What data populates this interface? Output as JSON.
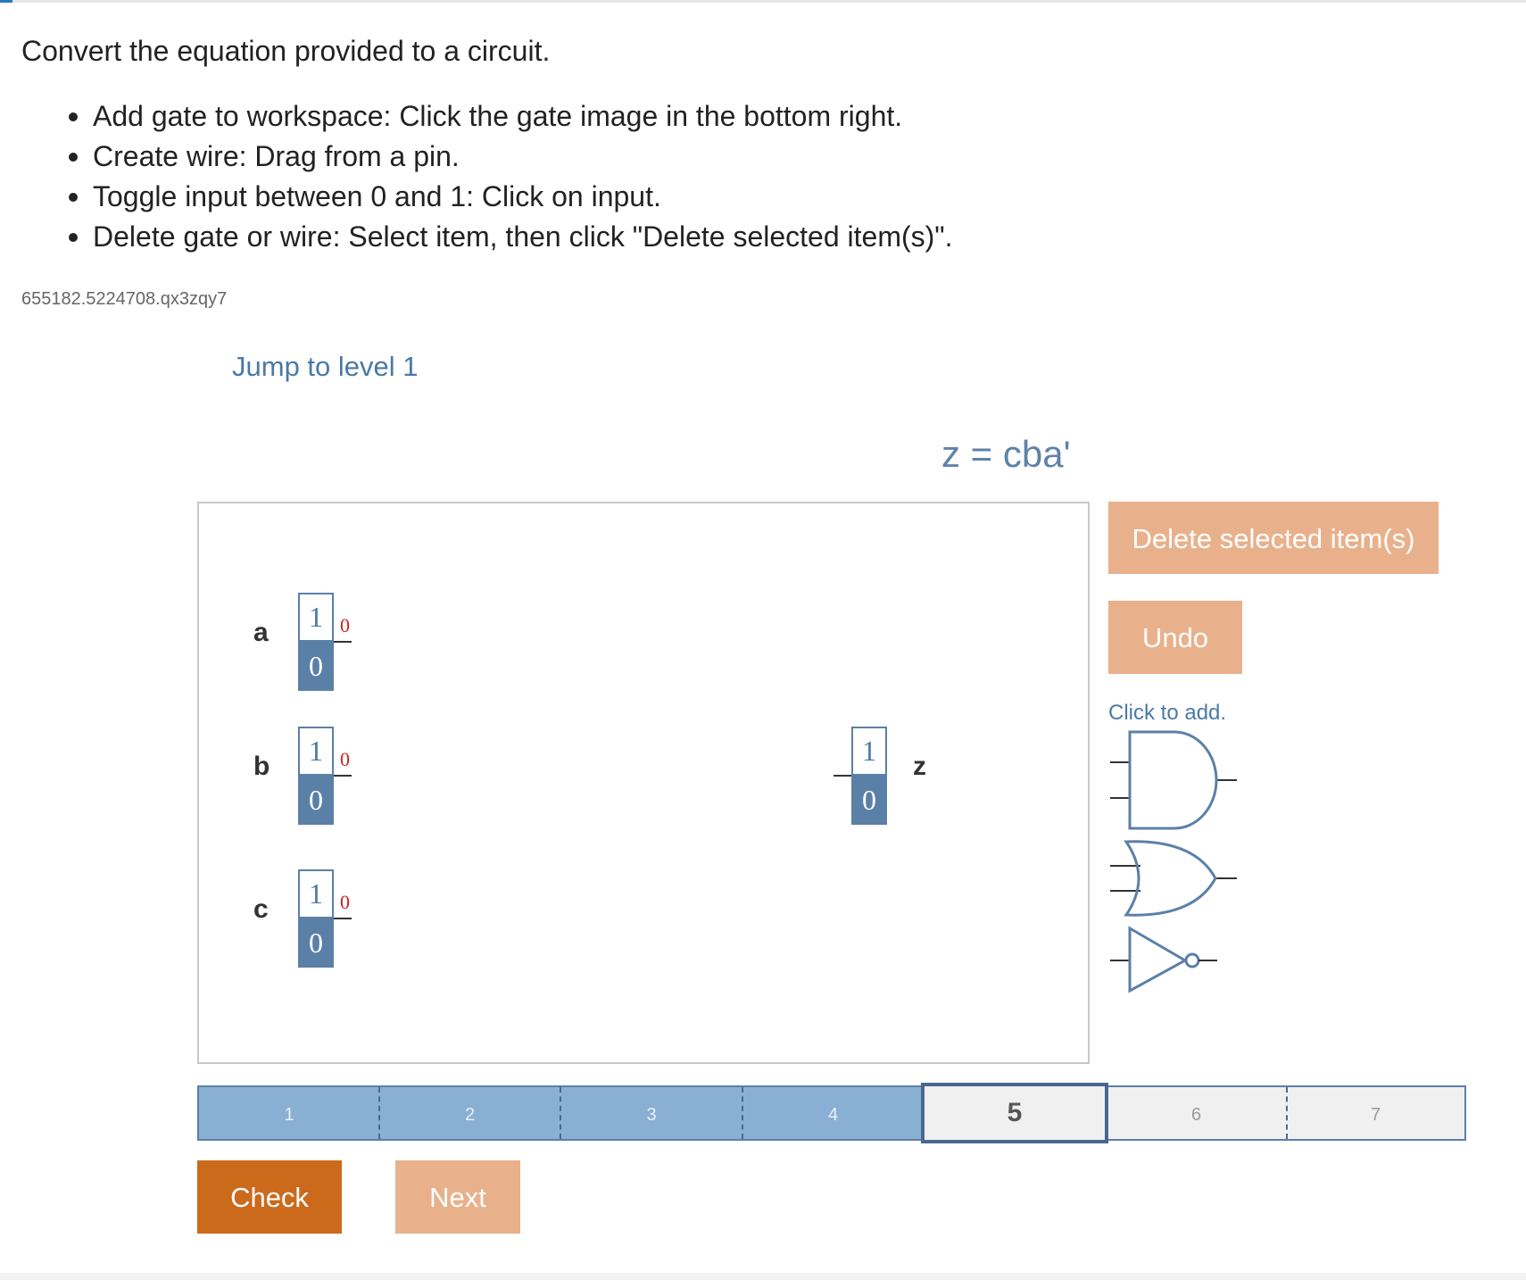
{
  "instructions": {
    "title": "Convert the equation provided to a circuit.",
    "steps": [
      "Add gate to workspace: Click the gate image in the bottom right.",
      "Create wire: Drag from a pin.",
      "Toggle input between 0 and 1: Click on input.",
      "Delete gate or wire: Select item, then click \"Delete selected item(s)\"."
    ]
  },
  "activity_id": "655182.5224708.qx3zqy7",
  "jump_link": "Jump to level 1",
  "equation": "z = cba'",
  "workspace": {
    "inputs": [
      {
        "name": "a",
        "one": "1",
        "zero": "0",
        "pin_value": "0"
      },
      {
        "name": "b",
        "one": "1",
        "zero": "0",
        "pin_value": "0"
      },
      {
        "name": "c",
        "one": "1",
        "zero": "0",
        "pin_value": "0"
      }
    ],
    "output": {
      "name": "z",
      "one": "1",
      "zero": "0"
    }
  },
  "toolbar": {
    "delete_label": "Delete selected item(s)",
    "undo_label": "Undo",
    "click_to_add": "Click to add.",
    "gates": [
      "and-gate-icon",
      "or-gate-icon",
      "not-gate-icon"
    ]
  },
  "levels": {
    "items": [
      "1",
      "2",
      "3",
      "4",
      "5",
      "6",
      "7"
    ],
    "completed": 4,
    "current": 5
  },
  "actions": {
    "check_label": "Check",
    "next_label": "Next"
  },
  "colors": {
    "accent_blue": "#5b80a8",
    "soft_orange": "#e8b18c",
    "check_orange": "#cc6a1c",
    "pin_red": "#cc2222"
  }
}
